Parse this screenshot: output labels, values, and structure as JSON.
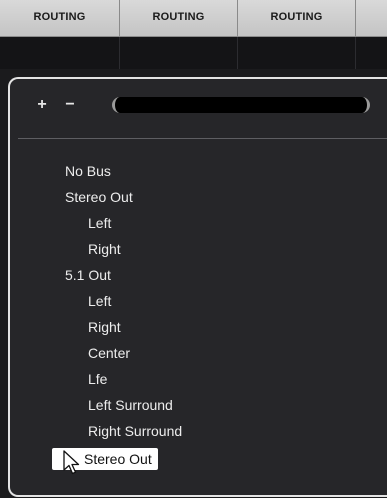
{
  "header": {
    "columns": [
      "ROUTING",
      "ROUTING",
      "ROUTING"
    ]
  },
  "popup": {
    "add_label": "+",
    "remove_label": "−",
    "search_value": "",
    "items": [
      {
        "label": "No Bus",
        "level": 0
      },
      {
        "label": "Stereo Out",
        "level": 0
      },
      {
        "label": "Left",
        "level": 1
      },
      {
        "label": "Right",
        "level": 1
      },
      {
        "label": "5.1 Out",
        "level": 0
      },
      {
        "label": "Left",
        "level": 1
      },
      {
        "label": "Right",
        "level": 1
      },
      {
        "label": "Center",
        "level": 1
      },
      {
        "label": "Lfe",
        "level": 1
      },
      {
        "label": "Left Surround",
        "level": 1
      },
      {
        "label": "Right Surround",
        "level": 1
      }
    ],
    "selected_item": "Stereo Out"
  },
  "colors": {
    "background": "#1b1b1d",
    "popup_background": "#262629",
    "popup_border": "#e4e4e4",
    "header_background": "#c4c4c4",
    "text": "#ededed",
    "selected_background": "#ffffff"
  }
}
